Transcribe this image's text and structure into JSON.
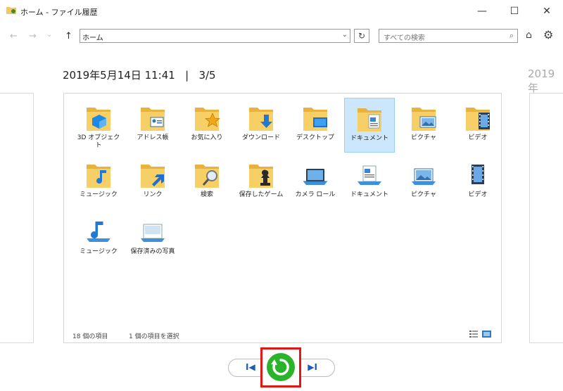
{
  "window": {
    "title": "ホーム - ファイル履歴",
    "controls": {
      "minimize": "—",
      "maximize": "☐",
      "close": "✕"
    }
  },
  "navbar": {
    "back": "←",
    "forward": "→",
    "recent": "⌄",
    "up": "↑",
    "address": "ホーム",
    "address_dropdown": "⌄",
    "refresh": "↻",
    "search_placeholder": "すべての検索",
    "search_icon": "magnifier-icon",
    "home_icon": "home-icon",
    "settings_icon": "gear-icon"
  },
  "snapshot": {
    "title": "2019年5月14日 11:41   |   3/5",
    "next_title": "2019年"
  },
  "items": [
    {
      "label": "3D オブジェクト",
      "icon": "3d-objects-folder-icon"
    },
    {
      "label": "アドレス帳",
      "icon": "contacts-folder-icon"
    },
    {
      "label": "お気に入り",
      "icon": "favorites-folder-icon"
    },
    {
      "label": "ダウンロード",
      "icon": "downloads-folder-icon"
    },
    {
      "label": "デスクトップ",
      "icon": "desktop-folder-icon"
    },
    {
      "label": "ドキュメント",
      "icon": "documents-folder-icon",
      "selected": true
    },
    {
      "label": "ピクチャ",
      "icon": "pictures-folder-icon"
    },
    {
      "label": "ビデオ",
      "icon": "videos-folder-icon"
    },
    {
      "label": "ミュージック",
      "icon": "music-folder-icon"
    },
    {
      "label": "リンク",
      "icon": "links-folder-icon"
    },
    {
      "label": "検索",
      "icon": "searches-folder-icon"
    },
    {
      "label": "保存したゲーム",
      "icon": "saved-games-folder-icon"
    },
    {
      "label": "カメラ ロール",
      "icon": "camera-roll-library-icon"
    },
    {
      "label": "ドキュメント",
      "icon": "documents-library-icon"
    },
    {
      "label": "ピクチャ",
      "icon": "pictures-library-icon"
    },
    {
      "label": "ビデオ",
      "icon": "videos-library-icon"
    },
    {
      "label": "ミュージック",
      "icon": "music-library-icon"
    },
    {
      "label": "保存済みの写真",
      "icon": "saved-pictures-library-icon"
    }
  ],
  "status": {
    "item_count": "18 個の項目",
    "selected_count": "1 個の項目を選択"
  },
  "controls": {
    "previous": "I◀",
    "next": "▶I",
    "restore_icon": "restore-icon"
  },
  "colors": {
    "selection": "#cce6fb",
    "restore_button": "#2bb32b",
    "highlight_box": "#e11818",
    "folder": "#f4c85a"
  }
}
